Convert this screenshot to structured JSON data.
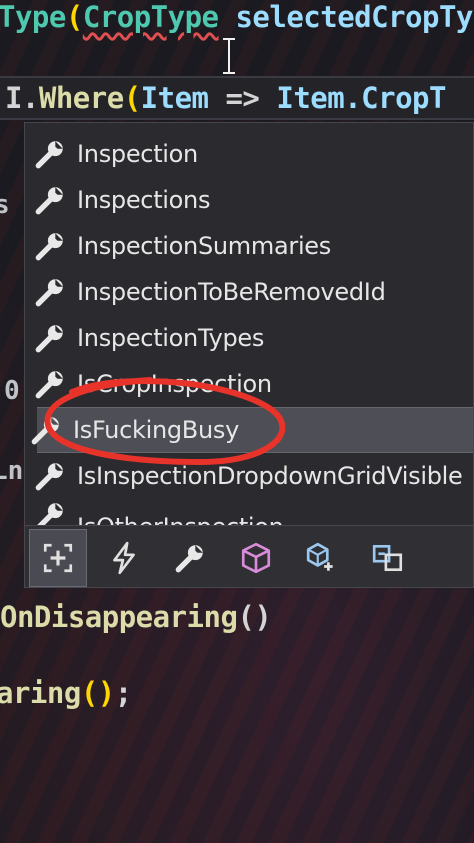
{
  "editor": {
    "line1": {
      "type1": "Type",
      "paren": "(",
      "type2": "CropType",
      "ident": " selectedCropTy"
    },
    "line2": {
      "prefix": ".I.",
      "method": "Where",
      "paren": "(",
      "param": "Item",
      "arrow": " => ",
      "ident": "Item.CropT"
    },
    "line3": {
      "text": "OnDisappearing",
      "parens": "()"
    },
    "line4": {
      "text": "aring",
      "parens": "()",
      "semi": ";"
    },
    "gutter": {
      "frag1": "s",
      "frag2": "0",
      "frag3": "Ln"
    }
  },
  "completion": {
    "items": [
      {
        "label": "Inspection"
      },
      {
        "label": "Inspections"
      },
      {
        "label": "InspectionSummaries"
      },
      {
        "label": "InspectionToBeRemovedId"
      },
      {
        "label": "InspectionTypes"
      },
      {
        "label": "IsCropInspection"
      },
      {
        "label": "IsFuckingBusy",
        "selected": true
      },
      {
        "label": "IsInspectionDropdownGridVisible"
      },
      {
        "label": "IsOtherInspection"
      }
    ],
    "filters": [
      {
        "icon": "expand-filter-icon",
        "active": true
      },
      {
        "icon": "event-bolt-icon"
      },
      {
        "icon": "wrench-property-icon"
      },
      {
        "icon": "cube-class-icon"
      },
      {
        "icon": "extension-method-icon"
      },
      {
        "icon": "snippet-icon"
      }
    ]
  },
  "colors": {
    "accent_red": "#e8332a",
    "type_color": "#4ec9b0",
    "ident_color": "#9cdcfe",
    "method_color": "#dcdcaa",
    "bracket_color": "#ffd700"
  }
}
